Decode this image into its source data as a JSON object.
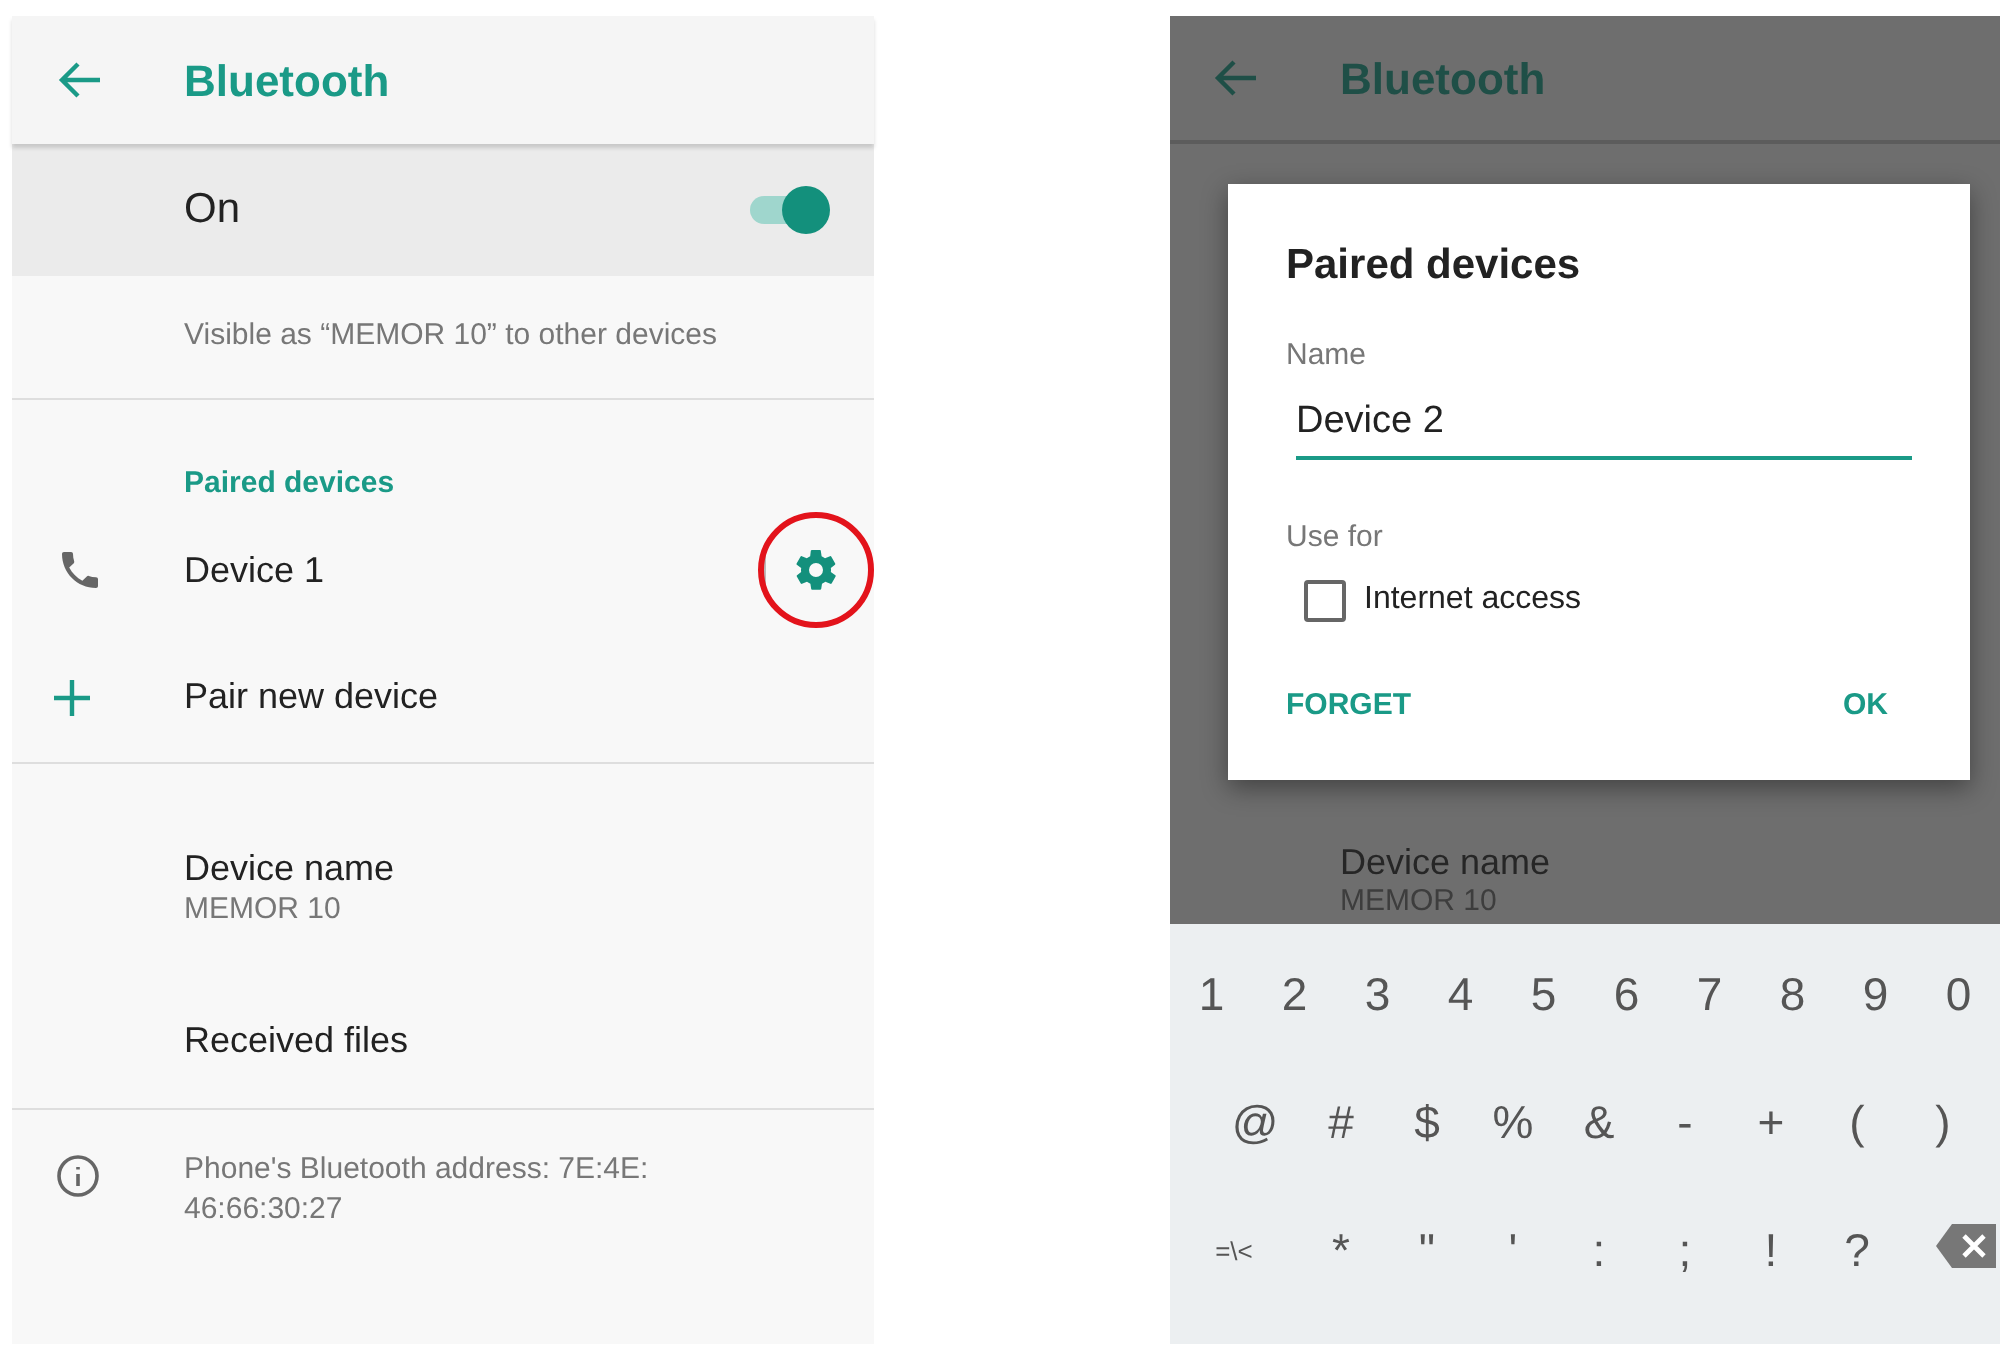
{
  "left_screen": {
    "header": {
      "title": "Bluetooth"
    },
    "toggle": {
      "label": "On",
      "on": true
    },
    "visibility_note": "Visible as “MEMOR 10” to other devices",
    "section_title": "Paired devices",
    "paired_devices": [
      {
        "name": "Device 1",
        "highlighted": true
      }
    ],
    "pair_new": "Pair new device",
    "device_name": {
      "label": "Device name",
      "value": "MEMOR 10"
    },
    "received_files": "Received files",
    "address_note": "Phone's Bluetooth address: 7E:4E: 46:66:30:27"
  },
  "right_screen": {
    "background": {
      "title": "Bluetooth",
      "device_name": {
        "label": "Device name",
        "value": "MEMOR 10"
      }
    },
    "dialog": {
      "title": "Paired devices",
      "name_label": "Name",
      "name_value": "Device 2",
      "use_for_label": "Use for",
      "options": [
        {
          "label": "Internet access",
          "checked": false
        }
      ],
      "buttons": [
        {
          "label": "FORGET"
        },
        {
          "label": "OK"
        }
      ]
    },
    "keyboard": {
      "rows": [
        [
          "1",
          "2",
          "3",
          "4",
          "5",
          "6",
          "7",
          "8",
          "9",
          "0"
        ],
        [
          "@",
          "#",
          "$",
          "%",
          "&",
          "-",
          "+",
          "(",
          ")"
        ],
        [
          "=\\<",
          "*",
          "\"",
          "'",
          ":",
          ";",
          "!",
          "?"
        ]
      ]
    }
  }
}
